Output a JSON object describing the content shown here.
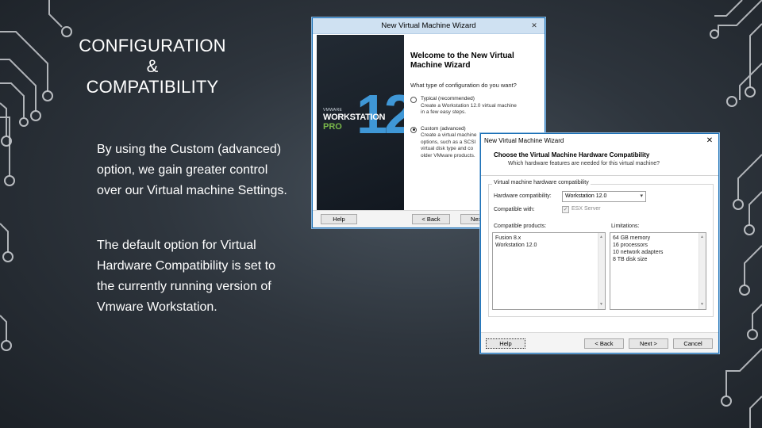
{
  "colors": {
    "background_center": "#46505a",
    "background_edge": "#1c2127",
    "circuit_line": "#c9ccd0",
    "vmware_blue": "#3f97d6",
    "vmware_green": "#7ab84a",
    "window_border": "#1a6fb5"
  },
  "slide": {
    "title_lines": [
      "CONFIGURATION",
      "&",
      "COMPATIBILITY"
    ],
    "bullet1_lines": [
      "By using the Custom (advanced)",
      "option, we gain greater control",
      "over our Virtual machine Settings."
    ],
    "bullet2_lines": [
      "The default option for Virtual",
      "Hardware Compatibility is set to",
      "the currently running version of",
      "Vmware Workstation."
    ]
  },
  "wizard1": {
    "title": "New Virtual Machine Wizard",
    "close_icon": "close-icon",
    "hero": {
      "vendor": "VMWARE",
      "product": "WORKSTATION",
      "edition": "PRO",
      "version": "12"
    },
    "heading_lines": [
      "Welcome to the New Virtual",
      "Machine Wizard"
    ],
    "question": "What type of configuration do you want?",
    "typical_label": "Typical (recommended)",
    "typical_desc_lines": [
      "Create a Workstation 12.0 virtual machine",
      "in a few easy steps."
    ],
    "custom_label": "Custom (advanced)",
    "custom_desc_lines": [
      "Create a virtual machine",
      "options, such as a SCSI",
      "virtual disk type and co",
      "older VMware products."
    ],
    "buttons": {
      "help": "Help",
      "back": "< Back",
      "next": "Next >"
    }
  },
  "wizard2": {
    "title": "New Virtual Machine Wizard",
    "close_icon": "close-icon",
    "heading": "Choose the Virtual Machine Hardware Compatibility",
    "subheading": "Which hardware features are needed for this virtual machine?",
    "group_label": "Virtual machine hardware compatibility",
    "hw_compat_label": "Hardware compatibility:",
    "hw_compat_value": "Workstation 12.0",
    "compatible_with_label": "Compatible with:",
    "esx_label": "ESX Server",
    "compatible_products_label": "Compatible products:",
    "compatible_products": [
      "Fusion 8.x",
      "Workstation 12.0"
    ],
    "limitations_label": "Limitations:",
    "limitations": [
      "64 GB memory",
      "16 processors",
      "10 network adapters",
      "8 TB disk size"
    ],
    "buttons": {
      "help": "Help",
      "back": "< Back",
      "next": "Next >",
      "cancel": "Cancel"
    }
  }
}
